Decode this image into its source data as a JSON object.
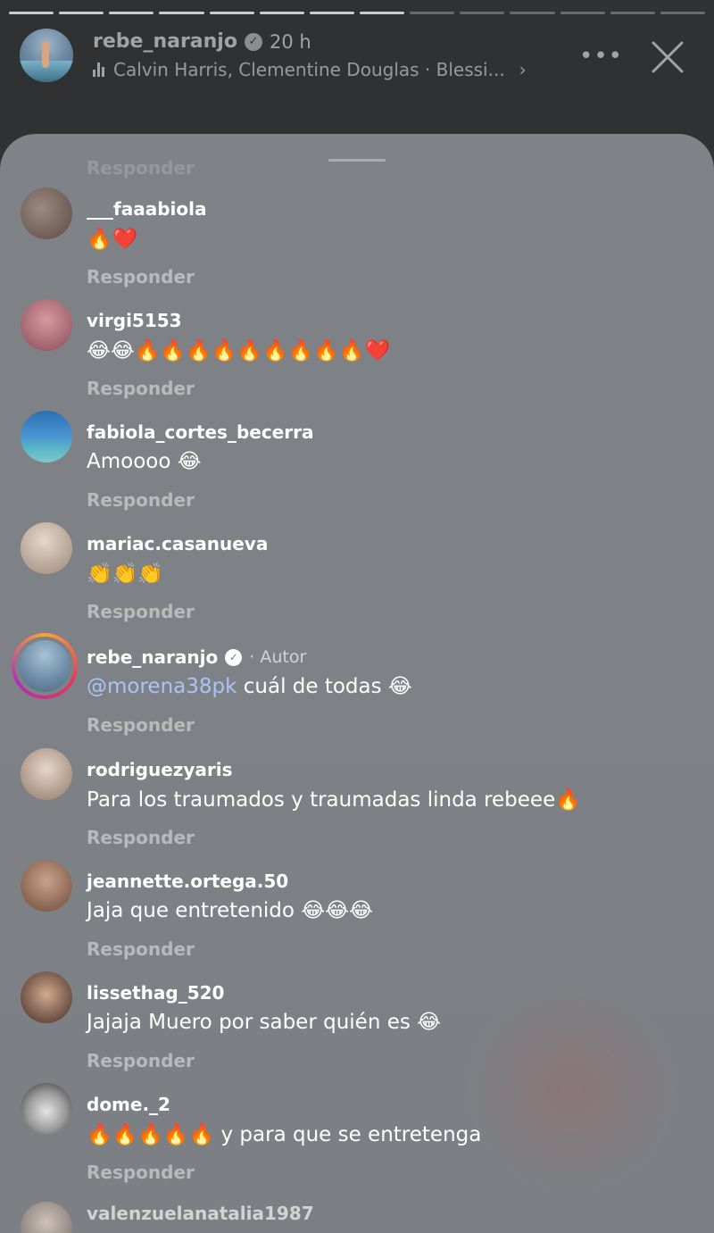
{
  "story": {
    "username": "rebe_naranjo",
    "time": "20 h",
    "music": "Calvin Harris, Clementine Douglas · Blessi...",
    "progress_segments_total": 14,
    "progress_segments_done": 8,
    "icons": {
      "verified": "verified-badge-icon",
      "music": "music-bars-icon",
      "more": "more-dots-icon",
      "close": "close-icon",
      "chevron": "chevron-right-icon"
    }
  },
  "sheet": {
    "faded_top_reply": "Responder"
  },
  "comments": [
    {
      "username": "___faaabiola",
      "text": "🔥❤️",
      "reply": "Responder",
      "avatar_color": "#6f5a52"
    },
    {
      "username": "virgi5153",
      "text": "😂😂🔥🔥🔥🔥🔥🔥🔥🔥🔥❤️",
      "reply": "Responder",
      "avatar_color": "#b06a70"
    },
    {
      "username": "fabiola_cortes_becerra",
      "text": "Amoooo 😂",
      "reply": "Responder",
      "avatar_color": "#3f7fb8"
    },
    {
      "username": "mariac.casanueva",
      "text": "👏👏👏",
      "reply": "Responder",
      "avatar_color": "#c9b7a8"
    },
    {
      "username": "rebe_naranjo",
      "author_label": "· Autor",
      "mention": "@morena38pk",
      "text": " cuál de todas 😂",
      "reply": "Responder"
    },
    {
      "username": "rodriguezyaris",
      "text": "Para los traumados y traumadas linda rebeee🔥",
      "reply": "Responder",
      "avatar_color": "#c6b3a2"
    },
    {
      "username": "jeannette.ortega.50",
      "text": "Jaja que entretenido 😂😂😂",
      "reply": "Responder",
      "avatar_color": "#a07864"
    },
    {
      "username": "lissethag_520",
      "text": "Jajaja Muero por saber quién es 😂",
      "reply": "Responder",
      "avatar_color": "#5e463d"
    },
    {
      "username": "dome._2",
      "text": "🔥🔥🔥🔥🔥 y para que se entretenga",
      "reply": "Responder",
      "avatar_color": "#cfcfcf"
    }
  ],
  "partial_comment": {
    "username": "valenzuelanatalia1987"
  }
}
